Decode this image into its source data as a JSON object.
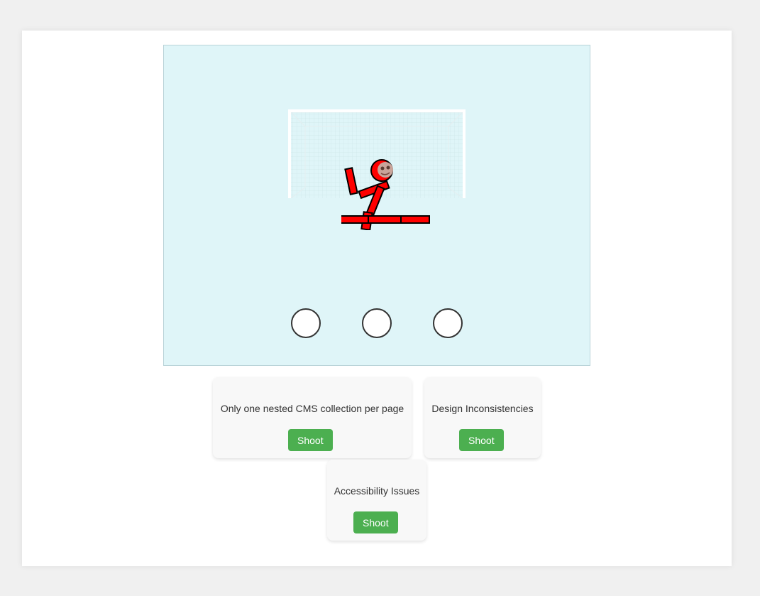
{
  "game": {
    "balls": [
      {
        "id": "left"
      },
      {
        "id": "center"
      },
      {
        "id": "right"
      }
    ],
    "keeper_color": "#ff0000",
    "field_color": "#dff5f8",
    "accent_color": "#4caf50"
  },
  "cards": [
    {
      "text": "Only one nested CMS collection per page",
      "button": "Shoot"
    },
    {
      "text": "Design Inconsistencies",
      "button": "Shoot"
    },
    {
      "text": "Accessibility Issues",
      "button": "Shoot"
    }
  ]
}
